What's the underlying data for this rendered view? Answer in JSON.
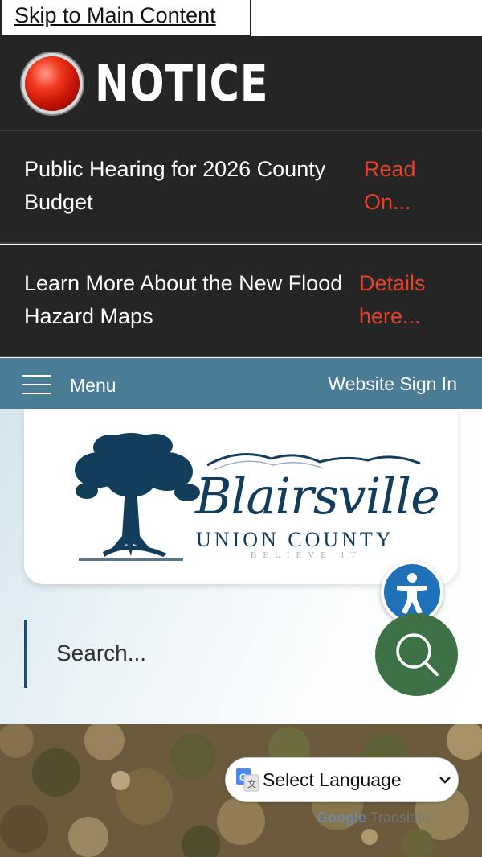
{
  "skip_link": "Skip to Main Content",
  "notice": {
    "title": "NOTICE",
    "items": [
      {
        "text": "Public Hearing for 2026 County Budget",
        "link": "Read On..."
      },
      {
        "text": "Learn More About the New Flood Hazard Maps",
        "link": "Details here..."
      }
    ]
  },
  "nav": {
    "menu_label": "Menu",
    "sign_in": "Website Sign In"
  },
  "logo": {
    "script": "Blairsville",
    "county": "UNION COUNTY",
    "tagline": "BELIEVE IT"
  },
  "search": {
    "placeholder": "Search..."
  },
  "translate": {
    "select_label": "Select Language",
    "powered_google": "Google",
    "powered_translate": "Translate"
  },
  "icons": {
    "notice": "notice-light-icon",
    "menu": "hamburger-icon",
    "accessibility": "accessibility-icon",
    "search": "search-icon",
    "google_translate": "google-translate-icon",
    "dropdown": "chevron-down-icon"
  },
  "colors": {
    "notice_bg": "#252525",
    "notice_link": "#e8412c",
    "nav_bg": "#4a7c95",
    "search_button": "#3c7245",
    "accessibility_button": "#1f72b8",
    "logo_navy": "#123e5c"
  }
}
